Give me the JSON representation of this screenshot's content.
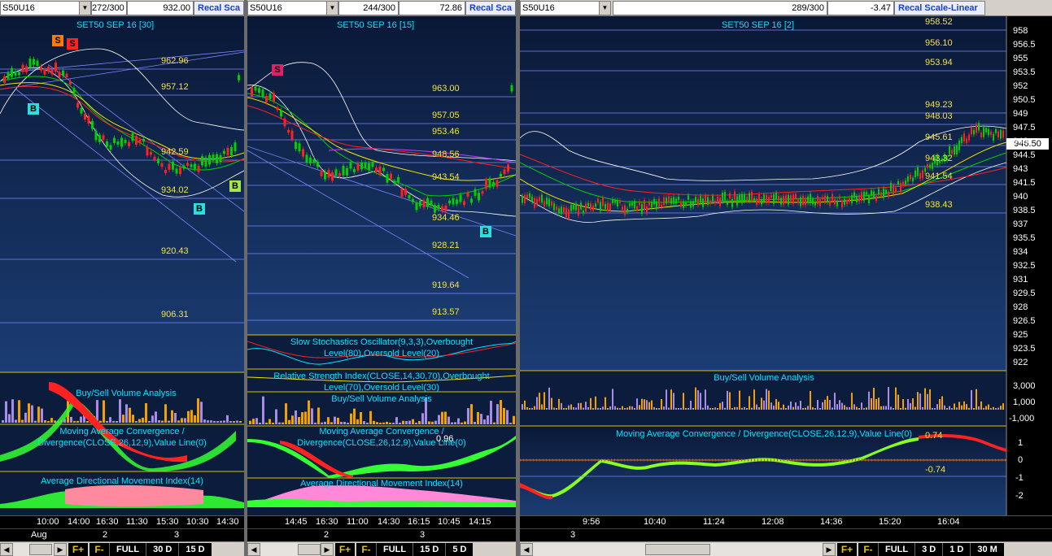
{
  "colors": {
    "background_top": "#0a1836",
    "background_bottom": "#1b3d74",
    "level_line": "#7a86ff",
    "level_text": "#f3e43a",
    "title_text": "#00e5ff",
    "ma_green": "#00d000",
    "ma_yellow": "#f0e000",
    "ma_red": "#ff2020",
    "bollinger": "#ffffff",
    "macd_up": "#33ff33",
    "macd_down": "#ff2222",
    "volume_orange": "#f4a000",
    "volume_violet": "#a98ce8",
    "adx_pink": "#ff8aa0",
    "recal_text": "#1b3fc9",
    "toolbar_bg": "#d4d0c8"
  },
  "panes": [
    {
      "symbol": "S50U16",
      "bars": "272/300",
      "price": "932.00",
      "recal_label": "Recal Sca",
      "chart_title": "SET50 SEP 16  [30]",
      "levels": [
        "962.96",
        "957.12",
        "942.59",
        "934.02",
        "920.43",
        "906.31"
      ],
      "markers": [
        "S",
        "S",
        "B",
        "B",
        "B"
      ],
      "indicators": [
        "Buy/Sell Volume Analysis",
        "Moving Average Convergence / Divergence(CLOSE,26,12,9),Value Line(0)",
        "Average Directional Movement Index(14)"
      ],
      "time_ticks": [
        "10:00",
        "14:00",
        "16:30",
        "11:30",
        "15:30",
        "10:30",
        "14:30"
      ],
      "date_ticks": [
        "Aug",
        "2",
        "3"
      ],
      "range_buttons": [
        "F+",
        "F-",
        "FULL",
        "30 D",
        "15 D"
      ]
    },
    {
      "symbol": "S50U16",
      "bars": "244/300",
      "price": "72.86",
      "recal_label": "Recal Sca",
      "chart_title": "SET50 SEP 16  [15]",
      "levels": [
        "963.00",
        "957.05",
        "953.46",
        "948.56",
        "943.54",
        "934.46",
        "928.21",
        "919.64",
        "913.57"
      ],
      "markers": [
        "S",
        "B"
      ],
      "indicators": [
        "Slow Stochastics Oscillator(9,3,3),Overbought Level(80),Oversold Level(20)",
        "Relative Strength Index(CLOSE,14,30,70),Overbought Level(70),Oversold Level(30)",
        "Buy/Sell Volume Analysis",
        "Moving Average Convergence / Divergence(CLOSE,26,12,9),Value Line(0)",
        "Average Directional Movement Index(14)"
      ],
      "macd_value": "0.96",
      "time_ticks": [
        "14:45",
        "16:30",
        "11:00",
        "14:30",
        "16:15",
        "10:45",
        "14:15"
      ],
      "date_ticks": [
        "2",
        "3"
      ],
      "range_buttons": [
        "F+",
        "F-",
        "FULL",
        "15 D",
        "5 D"
      ]
    },
    {
      "symbol": "S50U16",
      "bars": "289/300",
      "price": "-3.47",
      "recal_label": "Recal Scale-Linear",
      "chart_title": "SET50 SEP 16  [2]",
      "levels": [
        "958.52",
        "956.10",
        "953.94",
        "949.23",
        "948.03",
        "945.61",
        "943.32",
        "941.54",
        "938.43"
      ],
      "current_price": "946.50",
      "price_axis": [
        "958",
        "956.5",
        "955",
        "953.5",
        "952",
        "950.5",
        "949",
        "947.5",
        "946",
        "944.5",
        "943",
        "941.5",
        "940",
        "938.5",
        "937",
        "935.5",
        "934",
        "932.5",
        "931",
        "929.5",
        "928",
        "926.5",
        "925",
        "923.5",
        "922"
      ],
      "volume_axis": [
        "3,000",
        "1,000",
        "-1,000"
      ],
      "macd_axis": [
        "1",
        "0",
        "-1",
        "-2"
      ],
      "macd_values": [
        "0.74",
        "-0.74"
      ],
      "indicators": [
        "Buy/Sell Volume Analysis",
        "Moving Average Convergence / Divergence(CLOSE,26,12,9),Value Line(0)"
      ],
      "time_ticks": [
        "9:56",
        "10:40",
        "11:24",
        "12:08",
        "14:36",
        "15:20",
        "16:04"
      ],
      "date_ticks": [
        "3"
      ],
      "range_buttons": [
        "F+",
        "F-",
        "FULL",
        "3 D",
        "1 D",
        "30 M"
      ]
    }
  ]
}
